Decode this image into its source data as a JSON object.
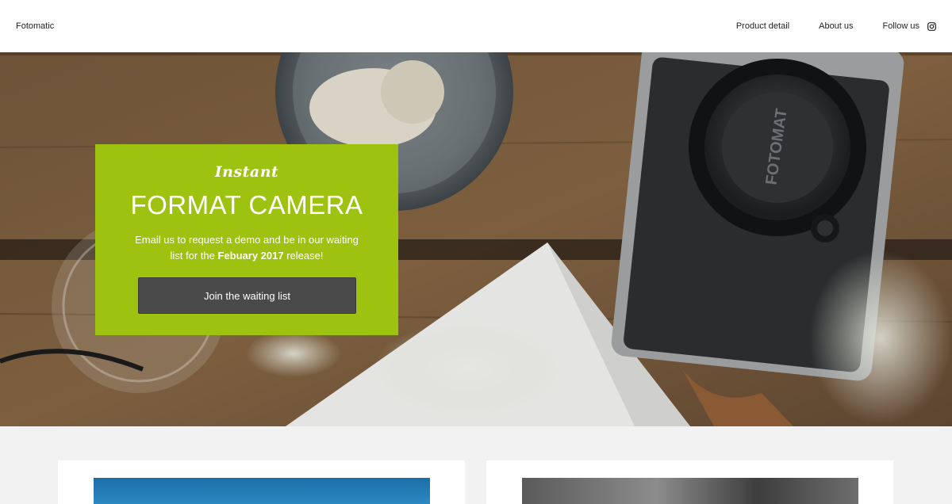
{
  "header": {
    "brand": "Fotomatic",
    "nav": {
      "product_detail": "Product detail",
      "about_us": "About us",
      "follow_us": "Follow us"
    }
  },
  "hero": {
    "tagline": "Instant",
    "title": "FORMAT CAMERA",
    "description_prefix": "Email us to request a demo and be in our waiting list for the ",
    "description_highlight": "Febuary 2017",
    "description_suffix": " release!",
    "cta_label": "Join the waiting list",
    "camera_brand": "FOTOMAT"
  },
  "colors": {
    "accent": "#9dc20f",
    "button": "#4a4a4a"
  },
  "icons": {
    "follow": "instagram-icon"
  }
}
